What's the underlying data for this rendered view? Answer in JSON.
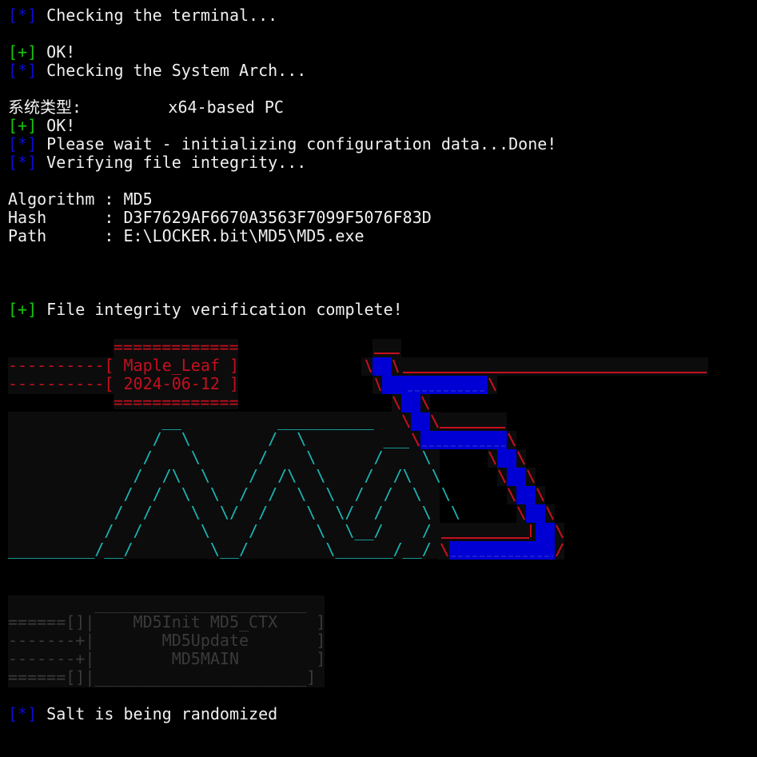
{
  "lines": {
    "l1": {
      "tag": "[*]",
      "text": " Checking the terminal..."
    },
    "l2": {
      "tag": "[+]",
      "text": " OK!"
    },
    "l3": {
      "tag": "[*]",
      "text": " Checking the System Arch..."
    },
    "l4": {
      "text": "系统类型:         x64-based PC"
    },
    "l5": {
      "tag": "[+]",
      "text": " OK!"
    },
    "l6": {
      "tag": "[*]",
      "text": " Please wait - initializing configuration data...Done!"
    },
    "l7": {
      "tag": "[*]",
      "text": " Verifying file integrity..."
    },
    "l8": {
      "text": "Algorithm : MD5"
    },
    "l9": {
      "text": "Hash      : D3F7629AF6670A3563F7099F5076F83D"
    },
    "l10": {
      "text": "Path      : E:\\LOCKER.bit\\MD5\\MD5.exe"
    },
    "l11": {
      "tag": "[+]",
      "text": " File integrity verification complete!"
    },
    "l12": {
      "tag": "[*]",
      "text": " Salt is being randomized"
    }
  },
  "banner": {
    "eq_top": "=============",
    "name_line": "----------[ Maple_Leaf ]",
    "date_line": "----------[ 2024-06-12 ]",
    "eq_bottom": "============="
  },
  "ascii_md5": [
    "                __          __________",
    "               /  \\        /  \\        ____",
    "              /    \\      /    \\      /    \\",
    "             /  /\\  \\    /  /\\  \\    /  /\\  \\",
    "            /  /  \\  \\  /  /  \\  \\  /  /  \\  \\",
    "           /  /    \\  \\/  /    \\  \\/  /    \\  \\",
    "          /  /      \\    /      \\  \\__/    /  /",
    "_________/__/        \\__/        \\______/__/"
  ],
  "menu": {
    "top": "         ______________________",
    "row1": "======[]|    MD5Init MD5_CTX    ]",
    "row2": "-------+|       MD5Update       ]",
    "row3": "-------+|        MD5MAIN        ]",
    "row4": "======[]|______________________]"
  },
  "colors": {
    "background": "#000000",
    "text": "#f0f0f0",
    "info_tag": "#0c0cd0",
    "ok_tag": "#16c60c",
    "banner_red": "#c50f1f",
    "ascii_cyan": "#1bb6b6",
    "block_blue": "#0000d4",
    "menu_grey": "#3a3a3a"
  }
}
